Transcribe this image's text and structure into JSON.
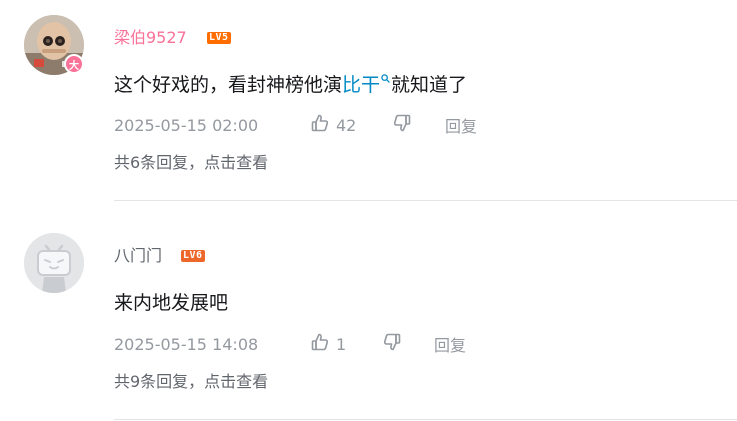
{
  "comments": [
    {
      "username": "梁伯9527",
      "level": "LV5",
      "badge": "大",
      "content_before": "这个好戏的，看封神榜他演",
      "content_highlight": "比干",
      "content_after": "就知道了",
      "time": "2025-05-15 02:00",
      "likes": "42",
      "reply_label": "回复",
      "sub_replies": "共6条回复，点击查看"
    },
    {
      "username": "八门门",
      "level": "LV6",
      "content": "来内地发展吧",
      "time": "2025-05-15 14:08",
      "likes": "1",
      "reply_label": "回复",
      "sub_replies": "共9条回复，点击查看"
    }
  ],
  "colors": {
    "vip_name": "#fb7299",
    "link": "#008ac5",
    "meta": "#9499a0",
    "level5": "#ff6c00",
    "level6": "#ee672a"
  },
  "icons": [
    "search-icon",
    "thumbs-up-icon",
    "thumbs-down-icon",
    "tv-mascot-icon"
  ]
}
